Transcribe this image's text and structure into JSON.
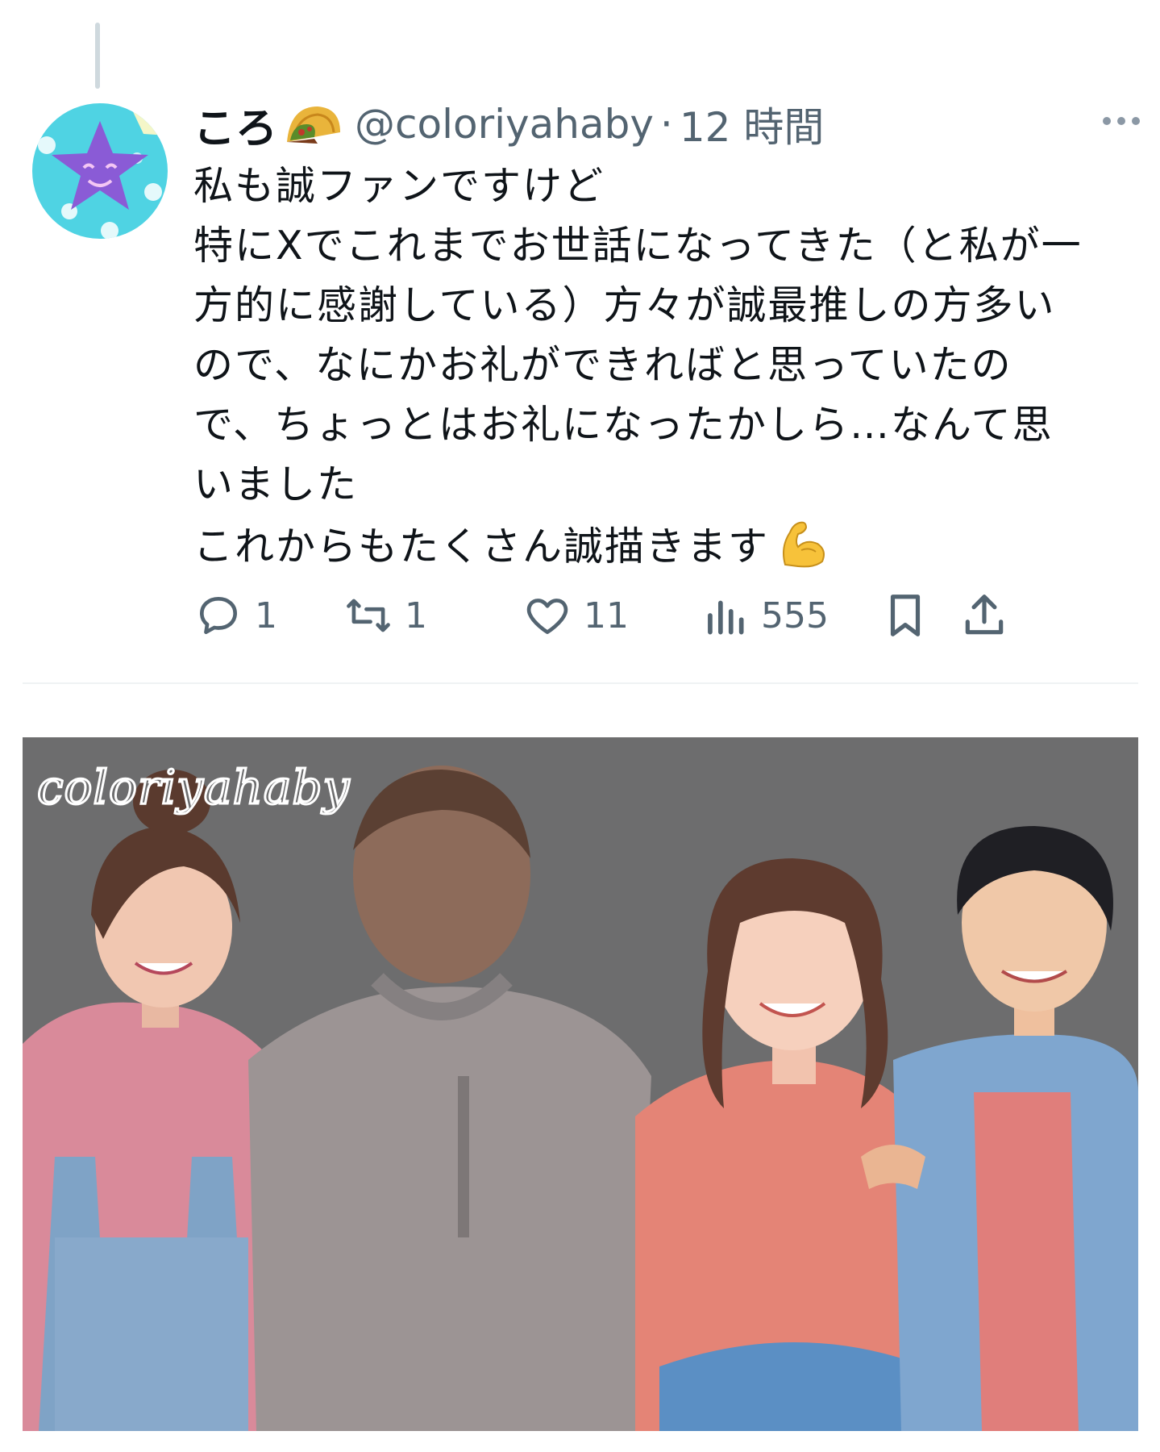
{
  "user": {
    "display_name": "ころ",
    "name_emoji": "taco-emoji",
    "handle": "@coloriyahaby",
    "separator": "·",
    "time": "12 時間"
  },
  "tweet": {
    "lines": [
      "私も誠ファンですけど",
      "特にXでこれまでお世話になってきた（と私が一",
      "方的に感謝している）方々が誠最推しの方多い",
      "ので、なにかお礼ができればと思っていたの",
      "で、ちょっとはお礼になったかしら…なんて思",
      "いました",
      "これからもたくさん誠描きます"
    ],
    "trailing_emoji": "flexed-biceps-emoji"
  },
  "actions": {
    "reply_count": "1",
    "retweet_count": "1",
    "like_count": "11",
    "views_count": "555"
  },
  "media": {
    "watermark": "coloriyahaby",
    "description_icons": [
      "painted-illustration-four-people"
    ]
  },
  "colors": {
    "text_primary": "#0f1419",
    "text_secondary": "#536471",
    "divider": "#eff3f4",
    "avatar_bg": "#4fd3e3",
    "avatar_star": "#8a5bd6"
  }
}
